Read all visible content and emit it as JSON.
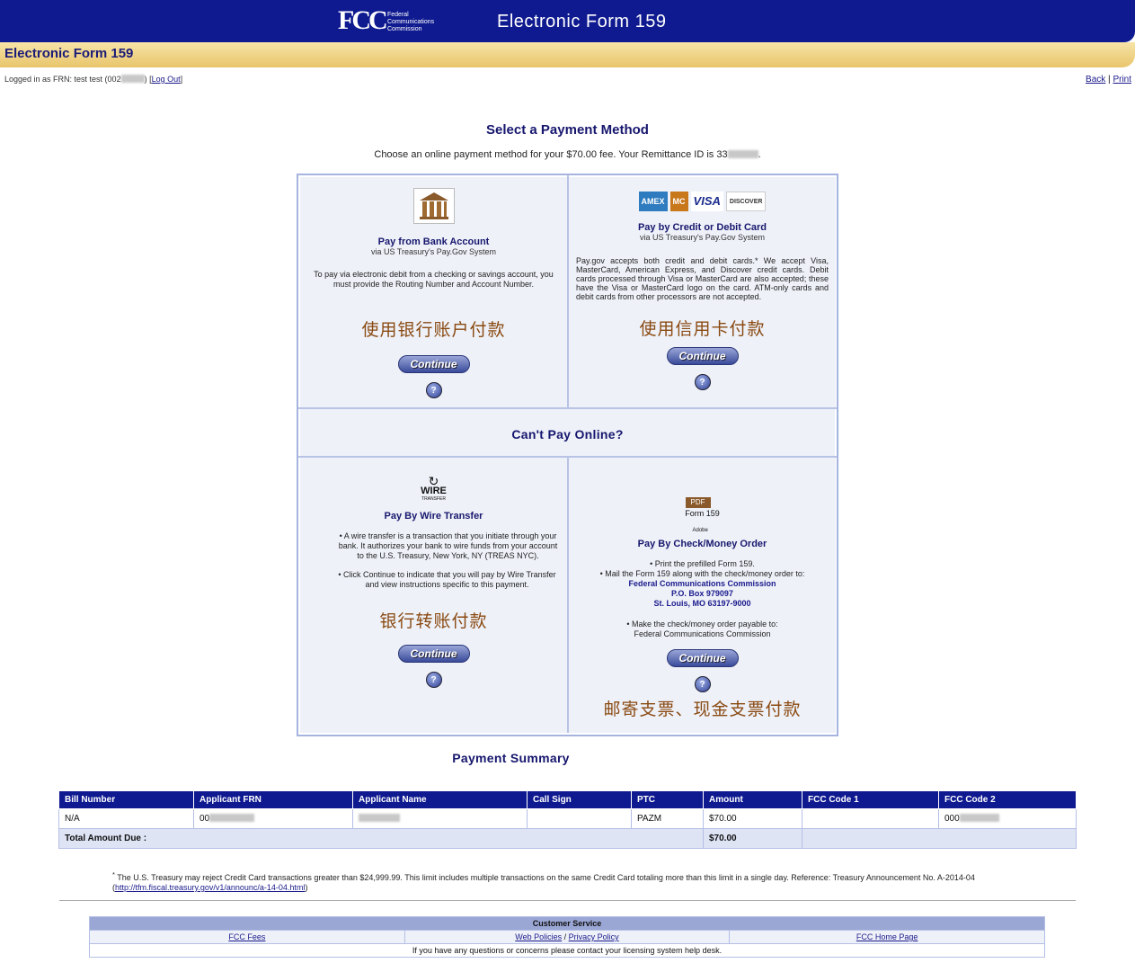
{
  "header": {
    "logo_text": "FCC",
    "logo_sub": "Federal Communications Commission",
    "app_title": "Electronic Form 159"
  },
  "subheader": {
    "title": "Electronic Form 159"
  },
  "login": {
    "text": "Logged in as FRN: test test (002",
    "text_end": ") [",
    "logout": "Log Out",
    "end": "]"
  },
  "toplinks": {
    "back": "Back",
    "sep": " | ",
    "print": "Print"
  },
  "main": {
    "heading": "Select a Payment Method",
    "intro": "Choose an online payment method for your $70.00 fee. Your Remittance ID is 33",
    "intro_end": ".",
    "bank": {
      "icon": "bank-icon",
      "title": "Pay from Bank Account",
      "sub": "via US Treasury's Pay.Gov System",
      "desc": "To pay via electronic debit from a checking or savings account, you must provide the Routing Number and Account Number.",
      "cn": "使用银行账户付款",
      "button": "Continue",
      "help": "?"
    },
    "card": {
      "logos": [
        "AMEX",
        "MC",
        "VISA",
        "DISCOVER"
      ],
      "title": "Pay by Credit or Debit Card",
      "sub": "via US Treasury's Pay.Gov System",
      "desc": "Pay.gov accepts both credit and debit cards.* We accept Visa, MasterCard, American Express, and Discover credit cards. Debit cards processed through Visa or MasterCard are also accepted; these have the Visa or MasterCard logo on the card. ATM-only cards and debit cards from other processors are not accepted.",
      "cn": "使用信用卡付款",
      "button": "Continue",
      "help": "?"
    },
    "cant_pay": "Can't Pay Online?",
    "wire": {
      "icon_text": "WIRE",
      "icon_sub": "TRANSFER",
      "title": "Pay By Wire Transfer",
      "b1": "A wire transfer is a transaction that you initiate through your bank. It authorizes your bank to wire funds from your account to the U.S. Treasury, New York, NY (TREAS NYC).",
      "b2": "Click Continue to indicate that you will pay by Wire Transfer and view instructions specific to this payment.",
      "cn": "银行转账付款",
      "button": "Continue",
      "help": "?"
    },
    "check": {
      "icon_text": "PDF",
      "icon_form": "Form 159",
      "icon_adobe": "Adobe",
      "title": "Pay By Check/Money Order",
      "b1": "Print the prefilled Form 159.",
      "b2": "Mail the Form 159 along with the check/money order to:",
      "addr1": "Federal Communications Commission",
      "addr2": "P.O. Box 979097",
      "addr3": "St. Louis, MO 63197-9000",
      "b3": "Make the check/money order payable to:",
      "b3b": "Federal Communications Commission",
      "cn": "邮寄支票、现金支票付款",
      "button": "Continue",
      "help": "?"
    }
  },
  "summary": {
    "title": "Payment Summary",
    "headers": [
      "Bill Number",
      "Applicant FRN",
      "Applicant Name",
      "Call Sign",
      "PTC",
      "Amount",
      "FCC Code 1",
      "FCC Code 2"
    ],
    "row": {
      "bill": "N/A",
      "frn": "00",
      "name": "",
      "call": "",
      "ptc": "PAZM",
      "amount": "$70.00",
      "code1": "",
      "code2": "000"
    },
    "total_label": "Total Amount Due :",
    "total_amount": "$70.00"
  },
  "footnote": {
    "mark": "*",
    "text": " The U.S. Treasury may reject Credit Card transactions greater than $24,999.99. This limit includes multiple transactions on the same Credit Card totaling more than this limit in a single day. Reference: Treasury Announcement No. A-2014-04 (",
    "link": "http://tfm.fiscal.treasury.gov/v1/announc/a-14-04.html",
    "end": ")"
  },
  "customer_service": {
    "title": "Customer Service",
    "fees": "FCC Fees",
    "web_policies": "Web Policies",
    "slash": " / ",
    "privacy": "Privacy Policy",
    "home": "FCC Home Page",
    "note": "If you have any questions or concerns please contact your licensing system help desk."
  }
}
